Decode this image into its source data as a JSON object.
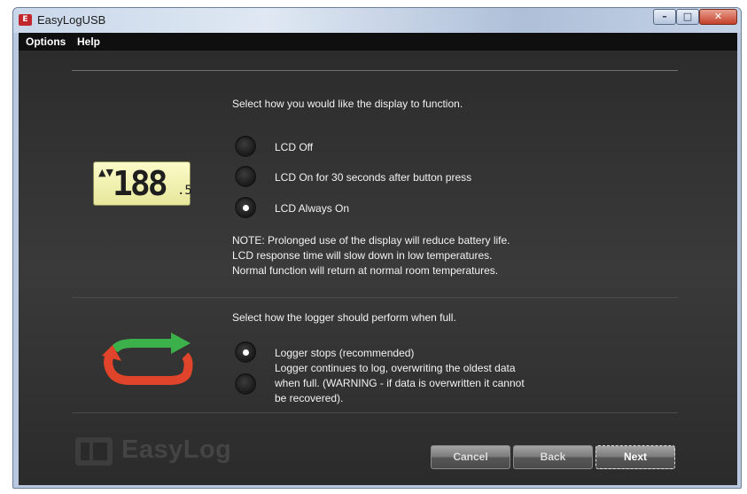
{
  "window": {
    "title": "EasyLogUSB",
    "icon": "app-icon",
    "controls": {
      "minimize": "–",
      "maximize": "□",
      "close": "✕"
    }
  },
  "menu": {
    "items": [
      {
        "label": "Options"
      },
      {
        "label": "Help"
      }
    ]
  },
  "display_section": {
    "prompt": "Select how you would like the display to function.",
    "options": [
      {
        "label": "LCD Off",
        "selected": false
      },
      {
        "label": "LCD On for 30 seconds after button press",
        "selected": false
      },
      {
        "label": "LCD Always On",
        "selected": true
      }
    ],
    "note_lines": [
      "NOTE: Prolonged use of the display will reduce battery life.",
      "LCD response time will slow down in low temperatures.",
      "Normal function will return at normal room temperatures."
    ],
    "lcd_icon": {
      "arrows": "▲▼",
      "digits": "188",
      "decimal": ".5"
    }
  },
  "logger_section": {
    "prompt": "Select how the logger should perform when full.",
    "options": [
      {
        "label": "Logger stops (recommended)",
        "selected": true
      },
      {
        "label": "Logger continues to log, overwriting the oldest data when full. (WARNING - if data is overwritten it cannot be recovered).",
        "selected": false
      }
    ],
    "icon": "cycle-arrows-icon"
  },
  "footer": {
    "logo_text": "EasyLog",
    "buttons": {
      "cancel": "Cancel",
      "back": "Back",
      "next": "Next"
    }
  },
  "colors": {
    "background": "#2f2f2f",
    "text": "#f2f2f2",
    "cycle_green": "#3cb04a",
    "cycle_red": "#e0442a"
  }
}
